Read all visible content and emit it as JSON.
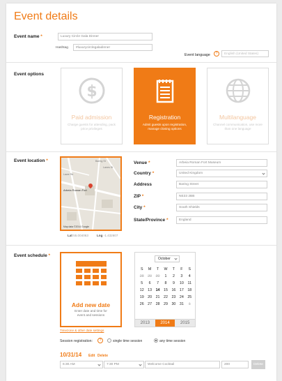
{
  "page": {
    "title": "Event details"
  },
  "event_name": {
    "label": "Event name",
    "value": "Luxury Circle Gala Dinner",
    "hashtag_label": "Hashtag",
    "hashtag_value": "#luxurycirclegaladinner",
    "language_label": "Event language",
    "language_value": "English (United States)"
  },
  "event_options": {
    "label": "Event options",
    "cards": [
      {
        "title": "Paid admission",
        "desc": "Charge guests for attending, pack price privileges",
        "active": false,
        "icon": "dollar-coin-icon"
      },
      {
        "title": "Registration",
        "desc": "Admit guests upon registration, manage closing options",
        "active": true,
        "icon": "notepad-icon"
      },
      {
        "title": "Multilanguage",
        "desc": "Channel communication, use more than one language",
        "active": false,
        "icon": "globe-icon"
      }
    ]
  },
  "event_location": {
    "label": "Event location",
    "map_labels": [
      "Arbeia Roman Fort",
      "Lawe Rd",
      "Baring St",
      "Lanes St"
    ],
    "map_attr": "Map data ©2014 Google",
    "lat_label": "Lat",
    "lat_value": "55.004063",
    "lng_label": "Lng",
    "lng_value": "-1.432607",
    "fields": [
      {
        "label": "Venue",
        "value": "Arbeia Roman Fort Museum",
        "required": true,
        "select": false
      },
      {
        "label": "Country",
        "value": "United Kingdom",
        "required": true,
        "select": true
      },
      {
        "label": "Address",
        "value": "Baring Street",
        "required": false,
        "select": false
      },
      {
        "label": "ZIP",
        "value": "NE33 2BB",
        "required": true,
        "select": false
      },
      {
        "label": "City",
        "value": "South Shields",
        "required": true,
        "select": false
      },
      {
        "label": "State/Province",
        "value": "England",
        "required": true,
        "select": false
      }
    ]
  },
  "event_schedule": {
    "label": "Event schedule",
    "add_title": "Add new date",
    "add_desc": "Enter date and time for event and sessions",
    "timezone_link": "Timezone & other date settings",
    "calendar": {
      "month": "October",
      "weekdays": [
        "S",
        "M",
        "T",
        "W",
        "T",
        "F",
        "S"
      ],
      "days": [
        "28",
        "29",
        "30",
        "1",
        "2",
        "3",
        "4",
        "5",
        "6",
        "7",
        "8",
        "9",
        "10",
        "11",
        "12",
        "13",
        "14",
        "15",
        "16",
        "17",
        "18",
        "19",
        "20",
        "21",
        "22",
        "23",
        "24",
        "25",
        "26",
        "27",
        "28",
        "29",
        "30",
        "31",
        "1"
      ],
      "years": [
        "2013",
        "2014",
        "2015"
      ],
      "selected_year": "2014"
    },
    "session_label": "Session registration:",
    "single_label": "single time session",
    "any_label": "any time session",
    "date": "10/31/14",
    "edit": "Edit",
    "delete": "Delete",
    "start_time": "6:30 AM",
    "end_time": "7:30 PM",
    "session_name": "Welcome Cocktail",
    "capacity": "200",
    "delete_button": "Delete"
  },
  "colors": {
    "accent": "#f07b16"
  }
}
